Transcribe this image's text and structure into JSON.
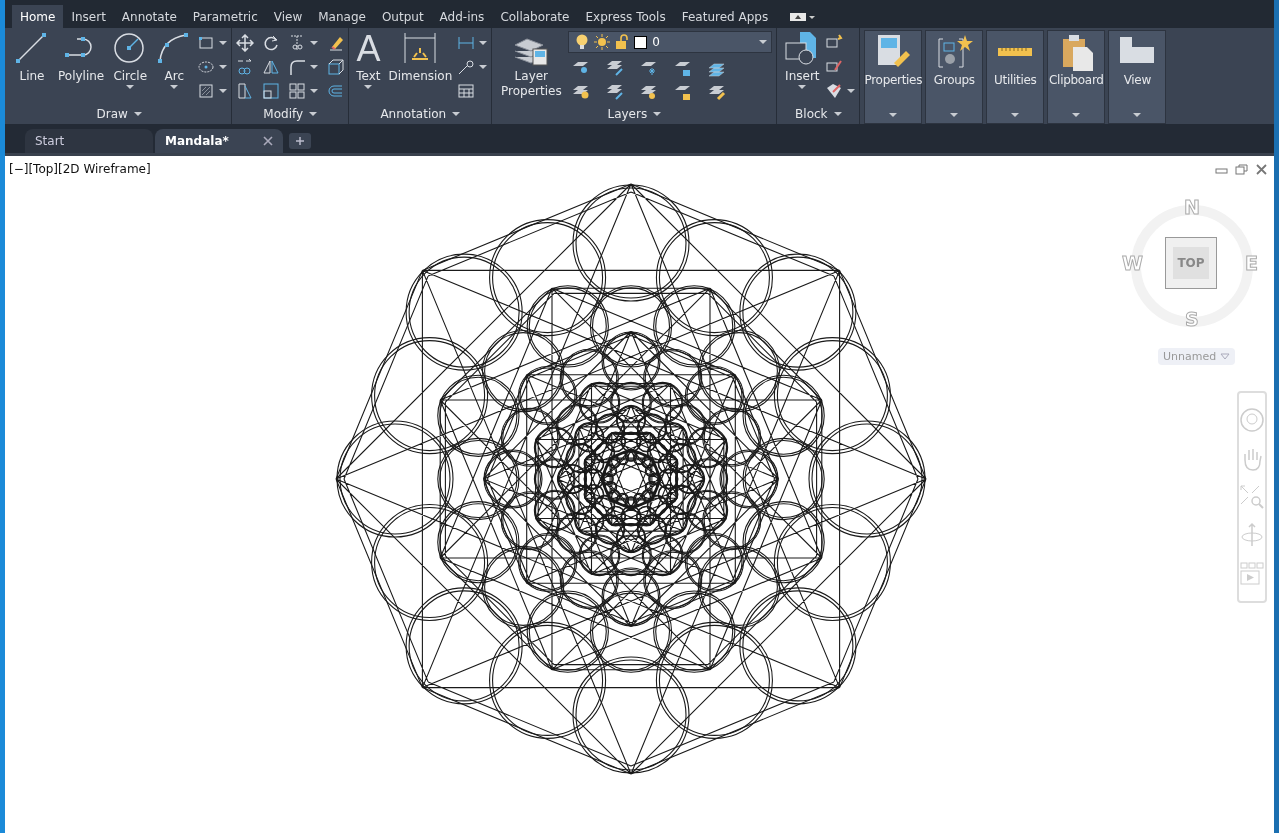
{
  "ribbon_tabs": [
    {
      "label": "Home",
      "selected": true
    },
    {
      "label": "Insert",
      "selected": false
    },
    {
      "label": "Annotate",
      "selected": false
    },
    {
      "label": "Parametric",
      "selected": false
    },
    {
      "label": "View",
      "selected": false
    },
    {
      "label": "Manage",
      "selected": false
    },
    {
      "label": "Output",
      "selected": false
    },
    {
      "label": "Add-ins",
      "selected": false
    },
    {
      "label": "Collaborate",
      "selected": false
    },
    {
      "label": "Express Tools",
      "selected": false
    },
    {
      "label": "Featured Apps",
      "selected": false
    }
  ],
  "panels": [
    {
      "title": "Draw",
      "large_tools": [
        {
          "label": "Line",
          "dropdown": false
        },
        {
          "label": "Polyline",
          "dropdown": false
        },
        {
          "label": "Circle",
          "dropdown": true
        },
        {
          "label": "Arc",
          "dropdown": true
        }
      ]
    },
    {
      "title": "Modify"
    },
    {
      "title": "Annotation",
      "large_tools": [
        {
          "label": "Text",
          "glyph": "A",
          "dropdown": true
        },
        {
          "label": "Dimension",
          "dropdown": false
        }
      ]
    },
    {
      "title": "Layers",
      "large_tools": [
        {
          "label": "Layer Properties",
          "dropdown": false
        }
      ],
      "layer": "0"
    },
    {
      "title": "Block",
      "large_tools": [
        {
          "label": "Insert",
          "dropdown": true
        }
      ]
    }
  ],
  "collapsed_panels": [
    "Properties",
    "Groups",
    "Utilities",
    "Clipboard",
    "View"
  ],
  "doc_tabs": [
    {
      "label": "Start",
      "selected": false
    },
    {
      "label": "Mandala*",
      "selected": true
    }
  ],
  "viewport_label": "[−][Top][2D Wireframe]",
  "viewcube": {
    "north": "N",
    "south": "S",
    "east": "E",
    "west": "W",
    "face": "TOP",
    "view_menu": "Unnamed"
  }
}
